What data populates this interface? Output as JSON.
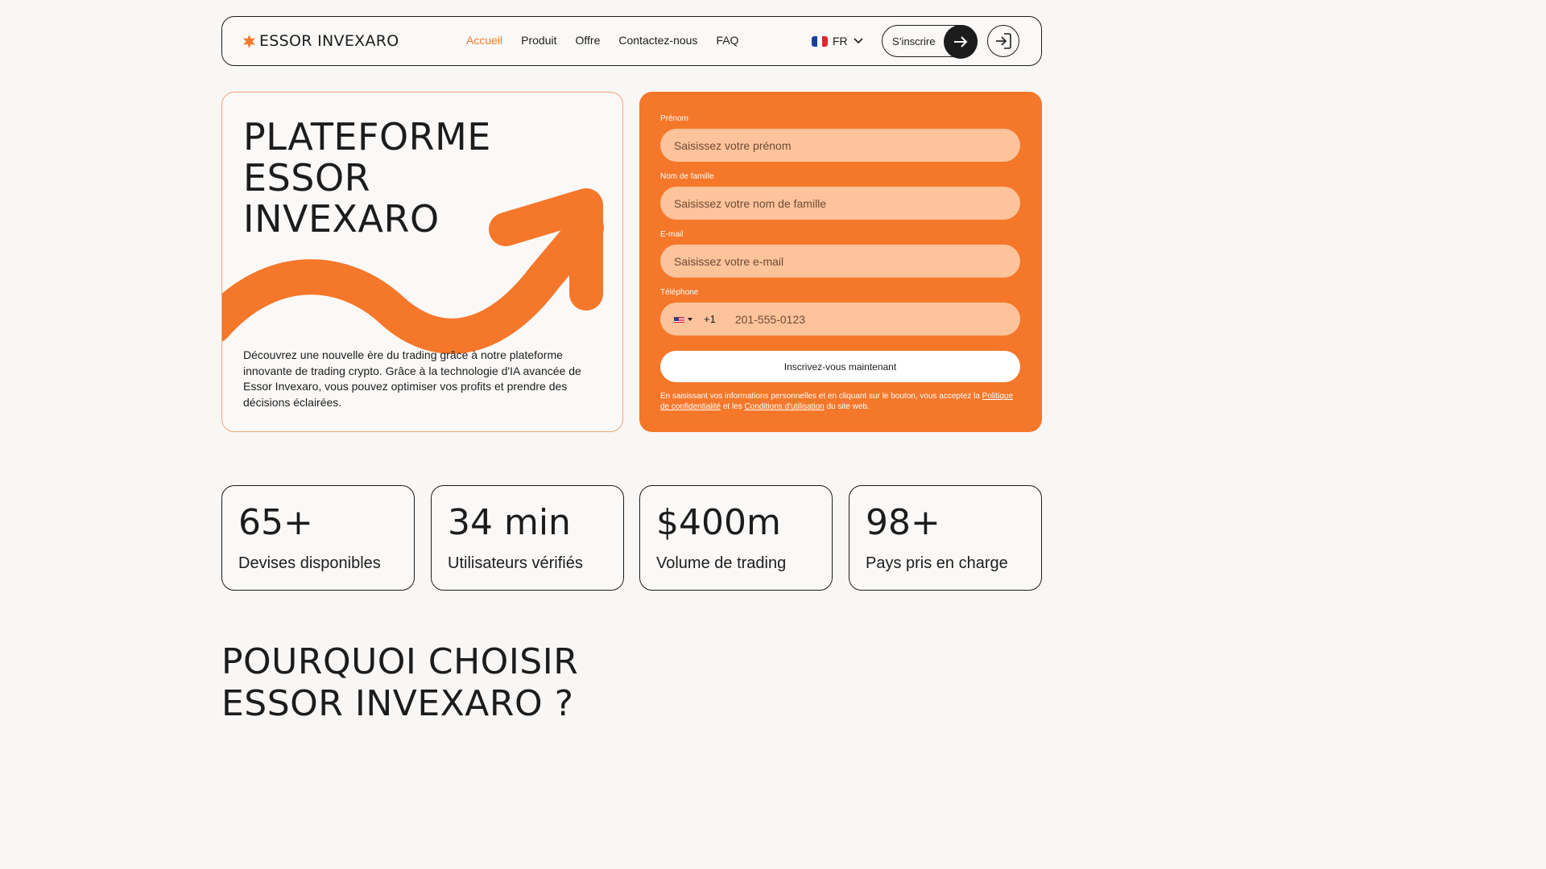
{
  "brand": {
    "name": "ESSOR INVEXARO",
    "accent": "#f47a2a"
  },
  "nav": {
    "items": [
      "Accueil",
      "Produit",
      "Offre",
      "Contactez-nous",
      "FAQ"
    ],
    "language": "FR",
    "signup_label": "S’inscrire"
  },
  "hero": {
    "title_lines": [
      "PLATEFORME",
      "ESSOR",
      "INVEXARO"
    ],
    "description": "Découvrez une nouvelle ère du trading grâce à notre plateforme innovante de trading crypto. Grâce à la technologie d'IA avancée de Essor Invexaro, vous pouvez optimiser vos profits et prendre des décisions éclairées."
  },
  "form": {
    "first_name_label": "Prénom",
    "first_name_placeholder": "Saisissez votre prénom",
    "last_name_label": "Nom de famille",
    "last_name_placeholder": "Saisissez votre nom de famille",
    "email_label": "E-mail",
    "email_placeholder": "Saisissez votre e-mail",
    "phone_label": "Téléphone",
    "phone_code": "+1",
    "phone_placeholder": "201-555-0123",
    "submit_label": "Inscrivez-vous maintenant",
    "legal_prefix": "En saisissant vos informations personnelles et en cliquant sur le bouton, vous acceptez la",
    "privacy_link": "Politique de confidentialité",
    "legal_and": "et les",
    "terms_link": "Conditions d'utilisation",
    "legal_suffix": "du site web."
  },
  "stats": [
    {
      "value": "65+",
      "label": "Devises disponibles"
    },
    {
      "value": "34 min",
      "label": "Utilisateurs vérifiés"
    },
    {
      "value": "$400m",
      "label": "Volume de trading"
    },
    {
      "value": "98+",
      "label": "Pays pris en charge"
    }
  ],
  "why": {
    "title_lines": [
      "POURQUOI CHOISIR",
      "ESSOR INVEXARO ?"
    ]
  }
}
